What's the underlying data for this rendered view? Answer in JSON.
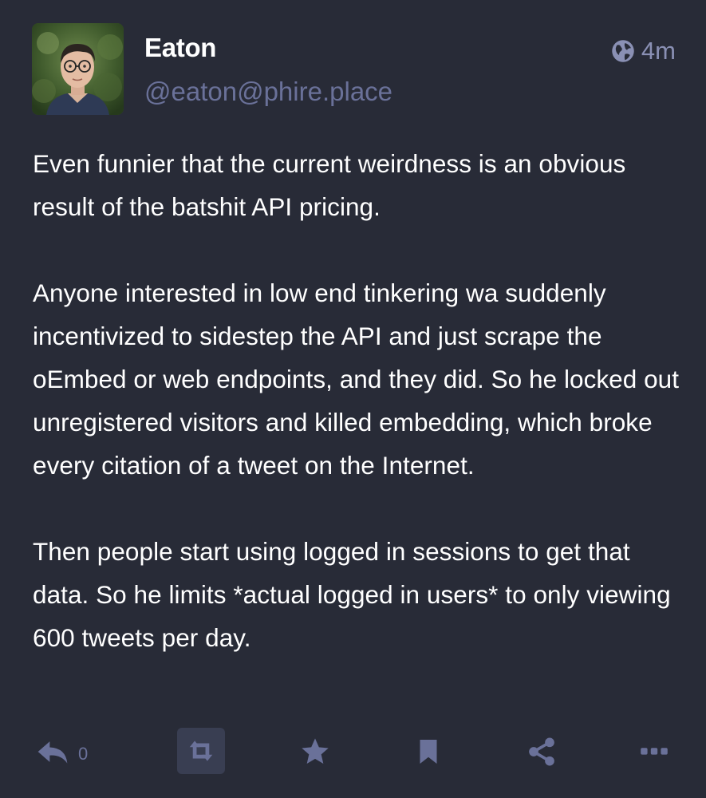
{
  "account": {
    "display_name": "Eaton",
    "handle": "@eaton@phire.place",
    "avatar_icon": "profile-photo"
  },
  "meta": {
    "visibility_icon": "globe-icon",
    "timestamp": "4m"
  },
  "content": {
    "paragraphs": [
      "Even funnier that the current weirdness is an obvious result of the batshit API pricing.",
      "Anyone interested in low end tinkering wa suddenly incentivized to sidestep the API and just scrape the oEmbed or web endpoints, and they did. So he locked out unregistered visitors and killed embedding, which broke every citation of a tweet on the Internet.",
      "Then people start using logged in sessions to get that data. So he limits *actual logged in users* to only viewing 600 tweets per day."
    ]
  },
  "actions": {
    "reply": {
      "icon": "reply-icon",
      "count": "0"
    },
    "boost": {
      "icon": "boost-icon",
      "active": true
    },
    "favourite": {
      "icon": "star-icon"
    },
    "bookmark": {
      "icon": "bookmark-icon"
    },
    "share": {
      "icon": "share-icon"
    },
    "more": {
      "icon": "more-icon"
    }
  },
  "colors": {
    "background": "#282b37",
    "text": "#ffffff",
    "handle": "#6a7199",
    "icon": "#6a7199",
    "boost_bg": "#393e52"
  }
}
